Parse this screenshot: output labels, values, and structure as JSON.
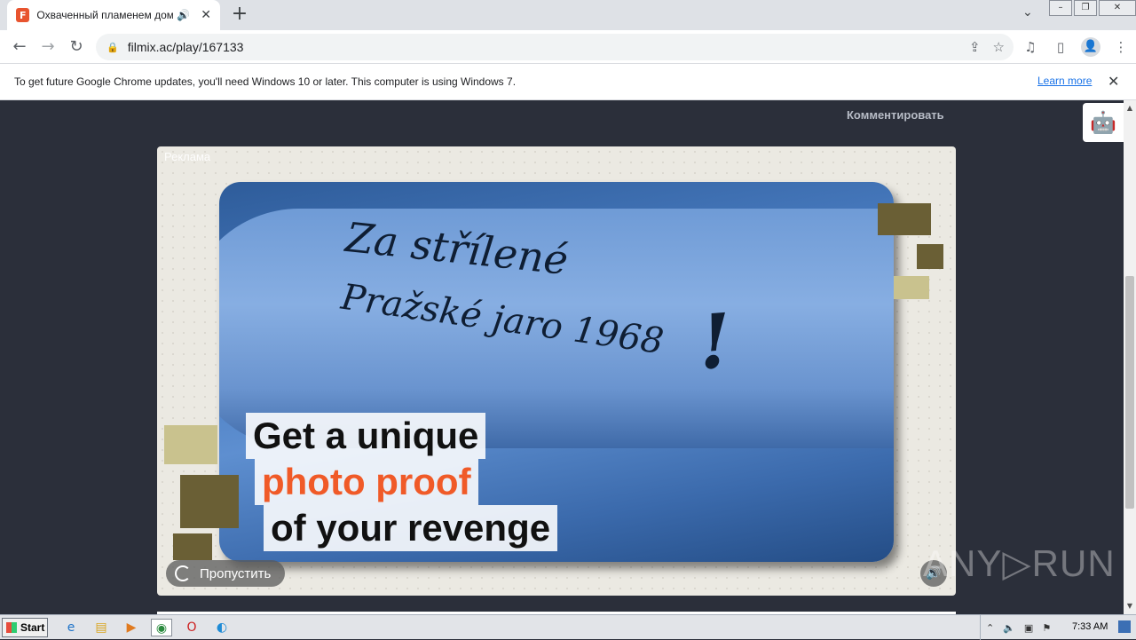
{
  "browser": {
    "tab_title": "Охваченный пламенем дом Мо",
    "tab_favicon_letter": "F",
    "favicon_color": "#e8542f",
    "audio_icon": "speaker-icon",
    "url": "filmix.ac/play/167133"
  },
  "infobar": {
    "message": "To get future Google Chrome updates, you'll need Windows 10 or later. This computer is using Windows 7.",
    "link_label": "Learn more"
  },
  "page": {
    "comment_label": "Комментировать",
    "ad": {
      "label": "Реклама",
      "photo_text": [
        "Za střílené",
        "Pražské jaro 1968",
        "!"
      ],
      "headline": [
        "Get a unique",
        "photo proof",
        "of your revenge"
      ],
      "accent_color": "#f05a28",
      "skip_label": "Пропустить"
    },
    "watermark": "ANY▷RUN"
  },
  "taskbar": {
    "start_label": "Start",
    "clock": "7:33 AM"
  }
}
